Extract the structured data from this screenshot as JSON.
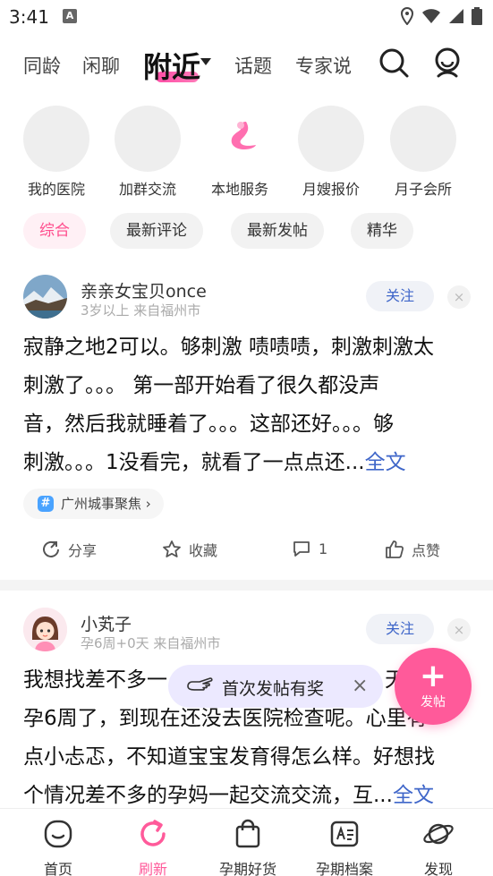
{
  "status": {
    "time": "3:41",
    "badge": "A"
  },
  "topnav": {
    "tabs": [
      "同龄",
      "闲聊",
      "附近",
      "话题",
      "专家说"
    ],
    "active_index": 2
  },
  "quick_entries": [
    {
      "label": "我的医院"
    },
    {
      "label": "加群交流"
    },
    {
      "label": "本地服务"
    },
    {
      "label": "月嫂报价"
    },
    {
      "label": "月子会所"
    }
  ],
  "filters": [
    {
      "label": "综合",
      "active": true
    },
    {
      "label": "最新评论"
    },
    {
      "label": "最新发帖"
    },
    {
      "label": "精华"
    }
  ],
  "posts": [
    {
      "user": "亲亲女宝贝once",
      "meta": "3岁以上 来自福州市",
      "follow": "关注",
      "close": "×",
      "lines": [
        "寂静之地2可以。够刺激 啧啧啧，刺激刺激太",
        "刺激了。。。 第一部开始看了很久都没声",
        "音，然后我就睡着了。。。这部还好。。。够",
        "刺激。。。1没看完，就看了一点点还..."
      ],
      "full_text": "全文",
      "topic": "广州城事聚焦",
      "topic_arrow": "›",
      "actions": {
        "share": "分享",
        "collect": "收藏",
        "comment": "1",
        "like": "点赞"
      }
    },
    {
      "user": "小芄子",
      "meta": "孕6周+0天 来自福州市",
      "follow": "关注",
      "close": "×",
      "lines": [
        "我想找差不多一",
        "孕6周了，到现在还没去医院检查呢。心里有",
        "点小忐忑，不知道宝宝发育得怎么样。好想找",
        "个情况差不多的孕妈一起交流交流，互..."
      ],
      "line1_tail": "天",
      "full_text": "全文"
    }
  ],
  "toast": {
    "text": "首次发帖有奖",
    "close": "×"
  },
  "fab": {
    "plus": "+",
    "label": "发帖"
  },
  "tabbar": {
    "tabs": [
      {
        "label": "首页"
      },
      {
        "label": "刷新",
        "active": true
      },
      {
        "label": "孕期好货"
      },
      {
        "label": "孕期档案"
      },
      {
        "label": "发现"
      }
    ]
  },
  "colors": {
    "accent": "#ff5a9a",
    "link": "#3f66c9"
  }
}
